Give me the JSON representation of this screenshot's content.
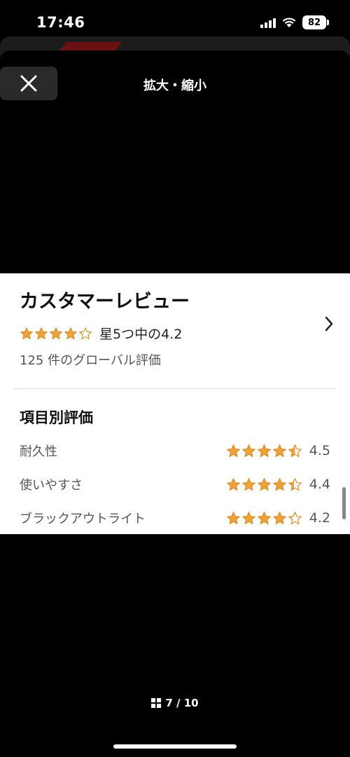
{
  "status_bar": {
    "time": "17:46",
    "battery": "82"
  },
  "modal": {
    "title": "拡大・縮小"
  },
  "review": {
    "heading": "カスタマーレビュー",
    "overall_rating": 4.2,
    "overall_text": "星5つ中の4.2",
    "global_count": "125 件のグローバル評価",
    "section_heading": "項目別評価",
    "criteria": [
      {
        "label": "耐久性",
        "value": "4.5",
        "rating": 4.5
      },
      {
        "label": "使いやすさ",
        "value": "4.4",
        "rating": 4.4
      },
      {
        "label": "ブラックアウトライト",
        "value": "4.2",
        "rating": 4.2
      }
    ]
  },
  "footer": {
    "page_indicator": "7 / 10"
  },
  "colors": {
    "star": "#F0A23A",
    "star_empty": "#C9C9C9",
    "background": "#000000",
    "panel": "#FFFFFF"
  }
}
